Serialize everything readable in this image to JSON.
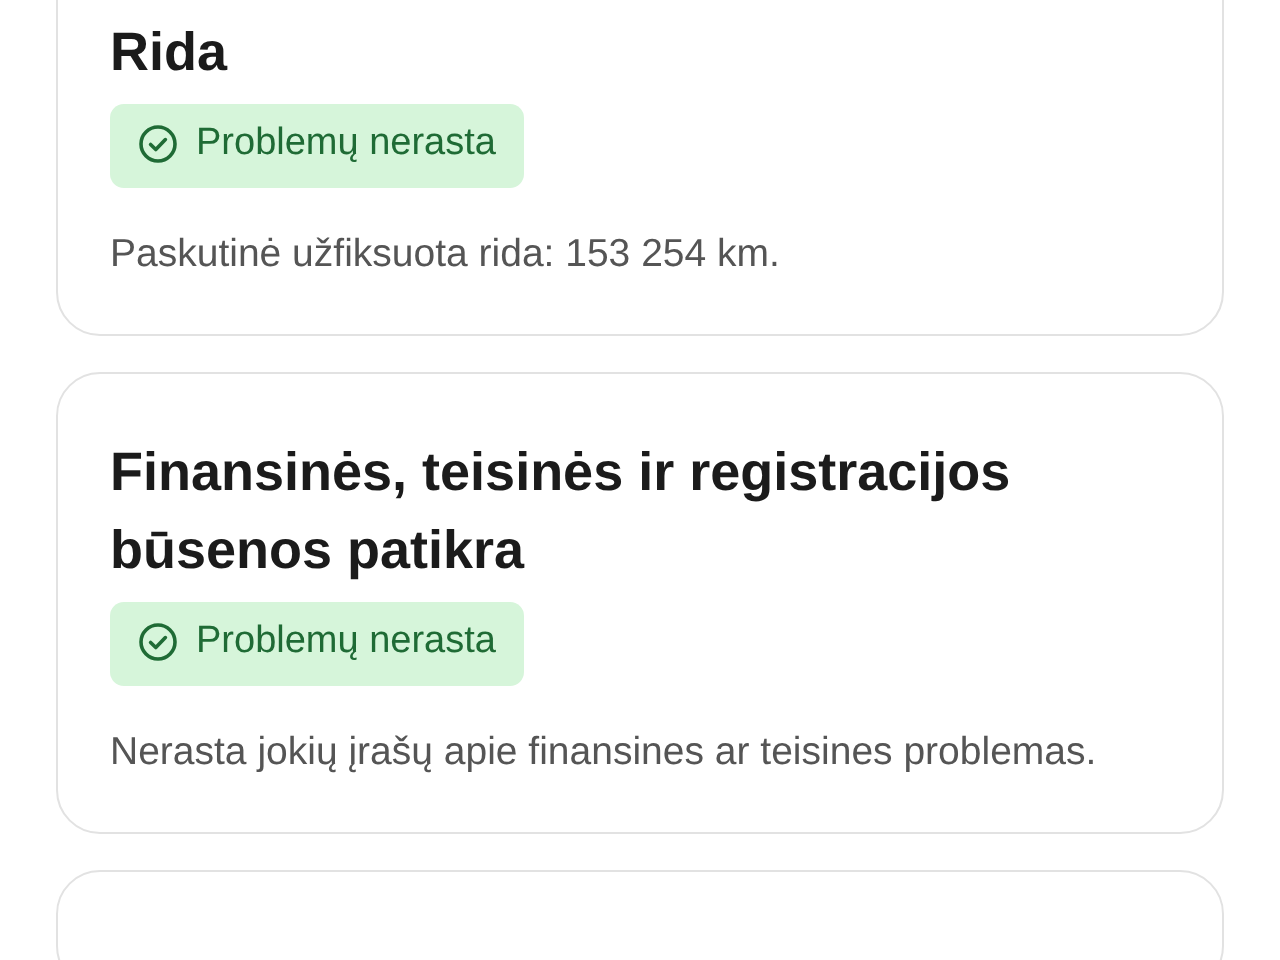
{
  "cards": [
    {
      "title": "Rida",
      "status": {
        "kind": "ok",
        "text": "Problemų nerasta"
      },
      "description": "Paskutinė užfiksuota rida: 153 254 km."
    },
    {
      "title": "Finansinės, teisinės ir registracijos būsenos patikra",
      "status": {
        "kind": "ok",
        "text": "Problemų nerasta"
      },
      "description": "Nerasta jokių įrašų apie finansines ar teisines problemas."
    }
  ]
}
